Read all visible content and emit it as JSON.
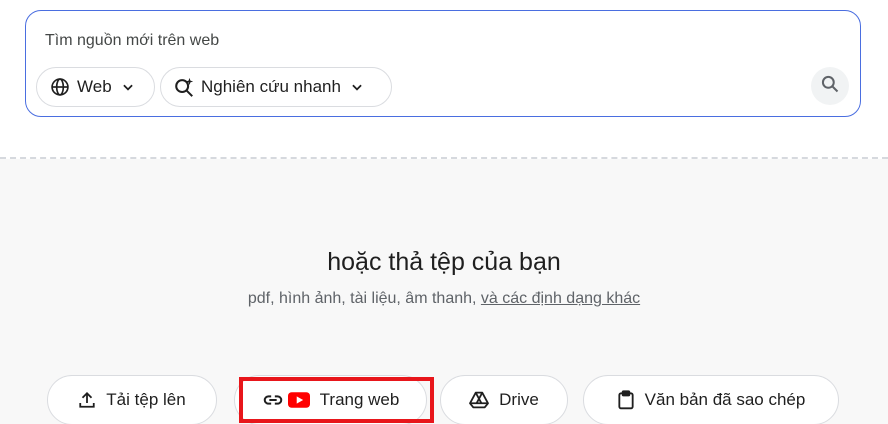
{
  "search": {
    "placeholder": "Tìm nguồn mới trên web",
    "web_chip": "Web",
    "research_chip": "Nghiên cứu nhanh"
  },
  "drop": {
    "title": "hoặc thả tệp của bạn",
    "subtitle_prefix": "pdf, hình ảnh, tài liệu, âm thanh, ",
    "subtitle_link": "và các định dạng khác"
  },
  "sources": {
    "upload": "Tải tệp lên",
    "website": "Trang web",
    "drive": "Drive",
    "copied_text": "Văn bản đã sao chép"
  },
  "colors": {
    "accent": "#4a6ee0",
    "highlight": "#e8161b",
    "youtube": "#ff0000"
  }
}
